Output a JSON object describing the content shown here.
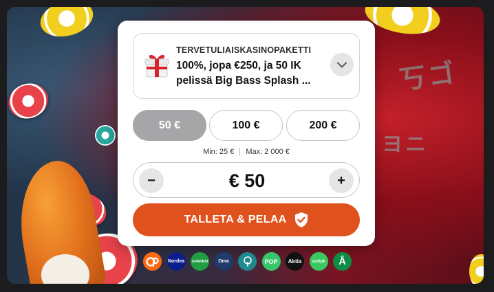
{
  "promo": {
    "kicker": "TERVETULIAISKASINOPAKETTI",
    "title": "100%, jopa €250, ja 50 IK pelissä Big Bass Splash ...",
    "icon": "gift-icon",
    "expand_icon": "chevron-down-icon"
  },
  "amounts": [
    {
      "label": "50 €",
      "selected": true
    },
    {
      "label": "100 €",
      "selected": false
    },
    {
      "label": "200 €",
      "selected": false
    }
  ],
  "limits": {
    "min": "Min: 25 €",
    "max": "Max: 2 000 €"
  },
  "stepper": {
    "minus": "−",
    "value": "€ 50",
    "plus": "+"
  },
  "cta": {
    "label": "TALLETA & PELAA",
    "icon": "shield-check-icon"
  },
  "banks": [
    {
      "name": "OP",
      "label": "",
      "color": "#ff6a10"
    },
    {
      "name": "Nordea",
      "label": "Nordea",
      "color": "#0a1e8c"
    },
    {
      "name": "Säästöpankki",
      "label": "S-PANKKI",
      "color": "#1f9e43"
    },
    {
      "name": "Oma Säästöpankki",
      "label": "Oma",
      "color": "#1f3a6b"
    },
    {
      "name": "Handelsbanken",
      "label": "",
      "color": "#1e8a90"
    },
    {
      "name": "POP Pankki",
      "label": "POP",
      "color": "#38c66a"
    },
    {
      "name": "Aktia",
      "label": "Aktia",
      "color": "#111111"
    },
    {
      "name": "Säästöpankki",
      "label": "sstöpk",
      "color": "#3ac860"
    },
    {
      "name": "Ålandsbanken",
      "label": "Å",
      "color": "#0e8c46"
    }
  ],
  "colors": {
    "accent": "#e0521d",
    "selected_amount": "#a6a6a9"
  }
}
